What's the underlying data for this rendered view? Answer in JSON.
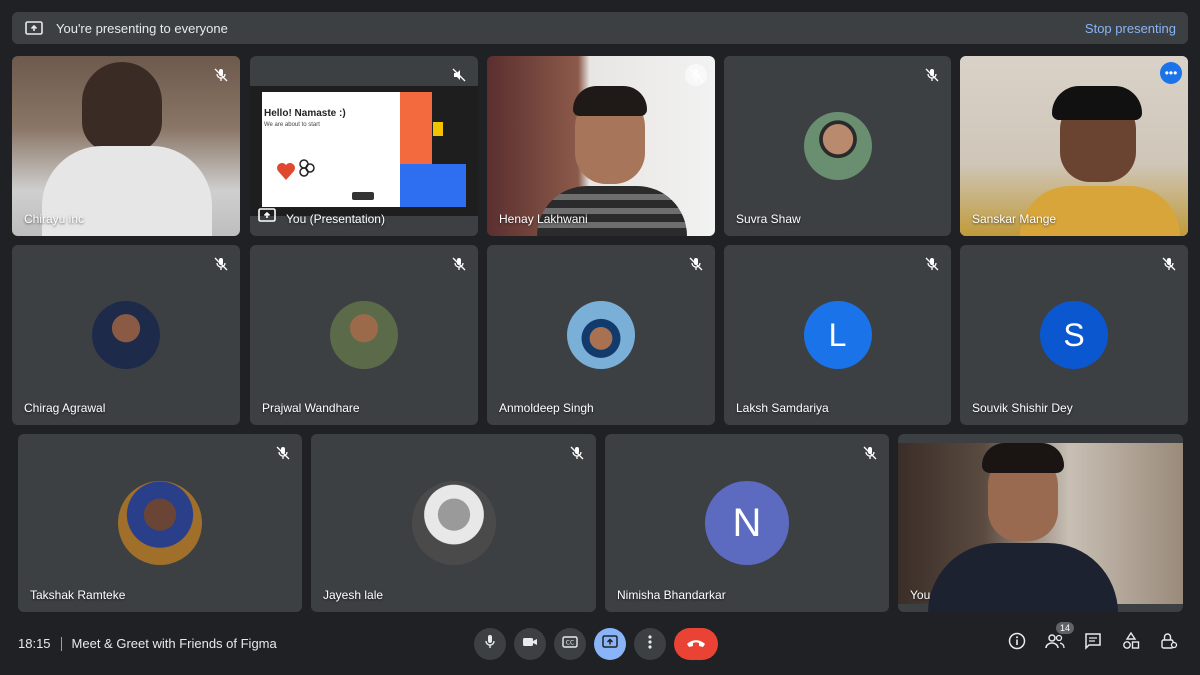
{
  "banner": {
    "text": "You're presenting to everyone",
    "stop_label": "Stop presenting"
  },
  "tiles": [
    {
      "name": "Chirayu inc"
    },
    {
      "name": "You (Presentation)",
      "slide_title": "Hello! Namaste :)",
      "slide_sub": "We are about to start"
    },
    {
      "name": "Henay Lakhwani"
    },
    {
      "name": "Suvra Shaw"
    },
    {
      "name": "Sanskar Mange"
    },
    {
      "name": "Chirag Agrawal"
    },
    {
      "name": "Prajwal Wandhare"
    },
    {
      "name": "Anmoldeep Singh"
    },
    {
      "name": "Laksh Samdariya",
      "letter": "L",
      "color": "#1a73e8"
    },
    {
      "name": "Souvik Shishir Dey",
      "letter": "S",
      "color": "#0b57d0"
    },
    {
      "name": "Takshak Ramteke"
    },
    {
      "name": "Jayesh lale"
    },
    {
      "name": "Nimisha Bhandarkar",
      "letter": "N",
      "color": "#5c6bc0"
    },
    {
      "name": "You"
    }
  ],
  "bottom": {
    "time": "18:15",
    "meeting_title": "Meet & Greet with Friends of Figma",
    "participant_count": "14"
  },
  "colors": {
    "accent": "#8ab4f8",
    "end_call": "#ea4335"
  }
}
